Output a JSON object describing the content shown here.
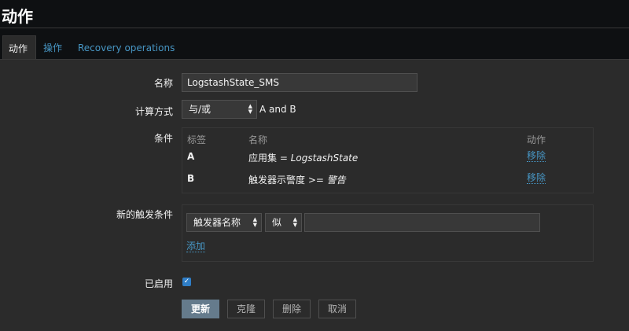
{
  "header": {
    "title": "动作"
  },
  "tabs": [
    {
      "label": "动作"
    },
    {
      "label": "操作"
    },
    {
      "label": "Recovery operations"
    }
  ],
  "form": {
    "name_label": "名称",
    "name_value": "LogstashState_SMS",
    "calc_label": "计算方式",
    "calc_value": "与/或",
    "calc_expression": "A and B",
    "conditions_label": "条件",
    "conditions": {
      "headers": [
        "标签",
        "名称",
        "动作"
      ],
      "rows": [
        {
          "label": "A",
          "name_prefix": "应用集 = ",
          "name_value": "LogstashState",
          "action": "移除"
        },
        {
          "label": "B",
          "name_prefix": "触发器示警度 >= ",
          "name_value": "警告",
          "action": "移除"
        }
      ]
    },
    "new_condition_label": "新的触发条件",
    "new_condition": {
      "type_value": "触发器名称",
      "operator_value": "似",
      "value": "",
      "add_label": "添加"
    },
    "enabled_label": "已启用",
    "enabled": true
  },
  "buttons": {
    "update": "更新",
    "clone": "克隆",
    "delete": "删除",
    "cancel": "取消"
  },
  "colors": {
    "link": "#4796c4",
    "panel": "#2b2b2b",
    "primary_button": "#657b8c",
    "checkbox": "#2f7ec7"
  }
}
